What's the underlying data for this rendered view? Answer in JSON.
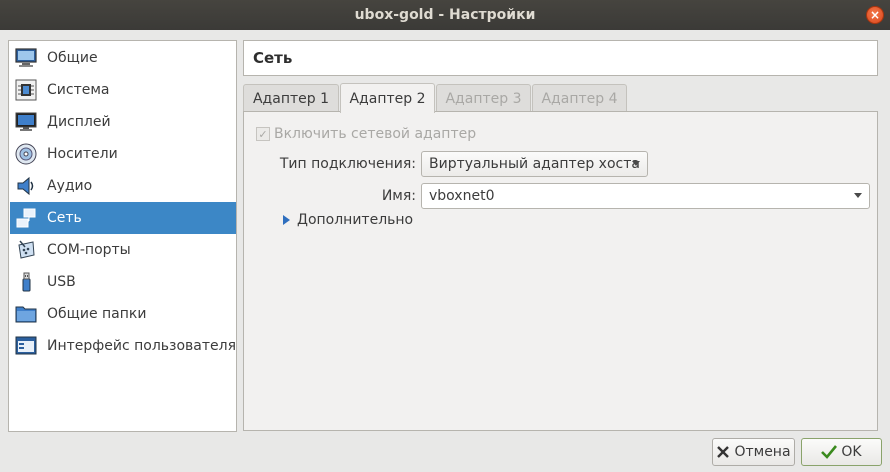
{
  "window": {
    "title": "ubox-gold - Настройки",
    "close_glyph": "×"
  },
  "sidebar": {
    "items": [
      {
        "label": "Общие",
        "icon": "general-monitor-icon"
      },
      {
        "label": "Система",
        "icon": "system-chip-icon"
      },
      {
        "label": "Дисплей",
        "icon": "display-monitor-icon"
      },
      {
        "label": "Носители",
        "icon": "storage-disc-icon"
      },
      {
        "label": "Аудио",
        "icon": "audio-speaker-icon"
      },
      {
        "label": "Сеть",
        "icon": "network-icon",
        "selected": true
      },
      {
        "label": "COM-порты",
        "icon": "serial-port-icon"
      },
      {
        "label": "USB",
        "icon": "usb-icon"
      },
      {
        "label": "Общие папки",
        "icon": "shared-folder-icon"
      },
      {
        "label": "Интерфейс пользователя",
        "icon": "user-interface-icon"
      }
    ]
  },
  "header": {
    "title": "Сеть"
  },
  "tabs": [
    {
      "label": "Адаптер 1",
      "state": "normal"
    },
    {
      "label": "Адаптер 2",
      "state": "active"
    },
    {
      "label": "Адаптер 3",
      "state": "disabled"
    },
    {
      "label": "Адаптер 4",
      "state": "disabled"
    }
  ],
  "adapter": {
    "enable_label": "Включить сетевой адаптер",
    "enable_checked": true,
    "attached_label": "Тип подключения:",
    "attached_value": "Виртуальный адаптер хоста",
    "name_label": "Имя:",
    "name_value": "vboxnet0",
    "advanced_label": "Дополнительно"
  },
  "buttons": {
    "cancel": "Отмена",
    "ok": "OK"
  },
  "colors": {
    "accent": "#3c87c6",
    "titlebar": "#3b3a37",
    "close": "#e9541f"
  }
}
